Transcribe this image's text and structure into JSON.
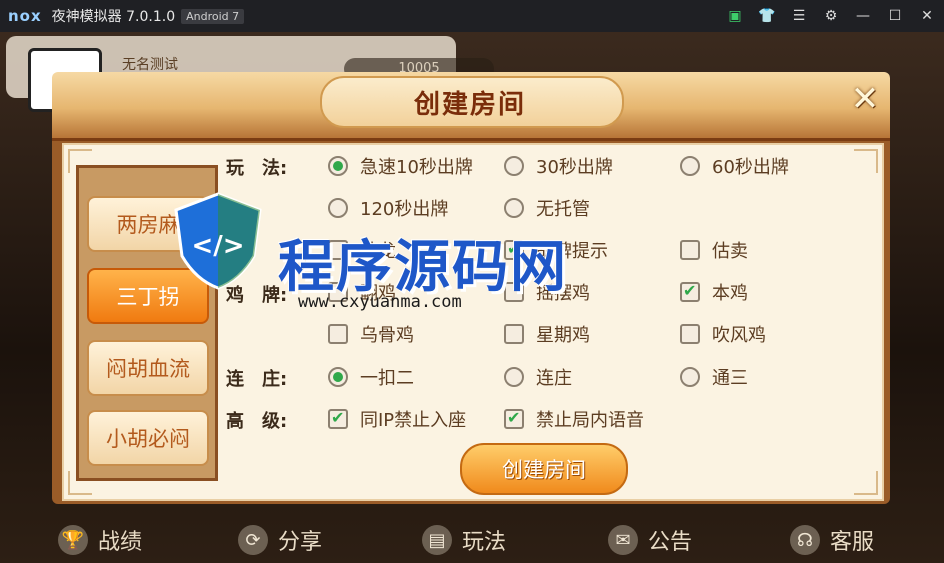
{
  "emulator": {
    "logo": "nox",
    "title": "夜神模拟器 7.0.1.0",
    "android_badge": "Android 7",
    "controls": [
      "store-icon",
      "shirt-icon",
      "menu-icon",
      "gear-icon",
      "minimize-icon",
      "maximize-icon",
      "close-icon"
    ]
  },
  "background": {
    "player_name": "无名测试",
    "coins": "10005"
  },
  "dialog": {
    "title": "创建房间",
    "tabs": [
      {
        "label": "两房麻",
        "active": false
      },
      {
        "label": "三丁拐",
        "active": true
      },
      {
        "label": "闷胡血流",
        "active": false
      },
      {
        "label": "小胡必闷",
        "active": false
      }
    ],
    "labels": {
      "play": "玩　法:",
      "chicken": "鸡　牌:",
      "banker": "连　庄:",
      "advanced": "高　级:"
    },
    "play_options": [
      {
        "text": "急速10秒出牌",
        "selected": true
      },
      {
        "text": "30秒出牌",
        "selected": false
      },
      {
        "text": "60秒出牌",
        "selected": false
      },
      {
        "text": "120秒出牌",
        "selected": false
      },
      {
        "text": "无托管",
        "selected": false
      }
    ],
    "play_checks": [
      {
        "text": "地龙",
        "checked": false
      },
      {
        "text": "胡牌提示",
        "checked": true
      },
      {
        "text": "估卖",
        "checked": false
      }
    ],
    "chicken_options": [
      {
        "text": "翻鸡",
        "checked": false
      },
      {
        "text": "摇摆鸡",
        "checked": false
      },
      {
        "text": "本鸡",
        "checked": true
      },
      {
        "text": "乌骨鸡",
        "checked": false
      },
      {
        "text": "星期鸡",
        "checked": false
      },
      {
        "text": "吹风鸡",
        "checked": false
      }
    ],
    "banker_options": [
      {
        "text": "一扣二",
        "selected": true
      },
      {
        "text": "连庄",
        "selected": false
      },
      {
        "text": "通三",
        "selected": false
      }
    ],
    "advanced_options": [
      {
        "text": "同IP禁止入座",
        "checked": true
      },
      {
        "text": "禁止局内语音",
        "checked": true
      }
    ],
    "create_button": "创建房间"
  },
  "watermark": {
    "text": "程序源码网",
    "url": "www.cxyuanma.com"
  },
  "bottom_nav": [
    {
      "label": "战绩",
      "icon": "trophy-icon"
    },
    {
      "label": "分享",
      "icon": "share-icon"
    },
    {
      "label": "玩法",
      "icon": "rules-book-icon"
    },
    {
      "label": "公告",
      "icon": "mail-icon"
    },
    {
      "label": "客服",
      "icon": "headset-icon"
    }
  ],
  "colors": {
    "accent_orange": "#f08a1c",
    "check_green": "#2fa84a",
    "panel_bg": "#fbf3e2",
    "title_brown": "#7a2d0a"
  }
}
